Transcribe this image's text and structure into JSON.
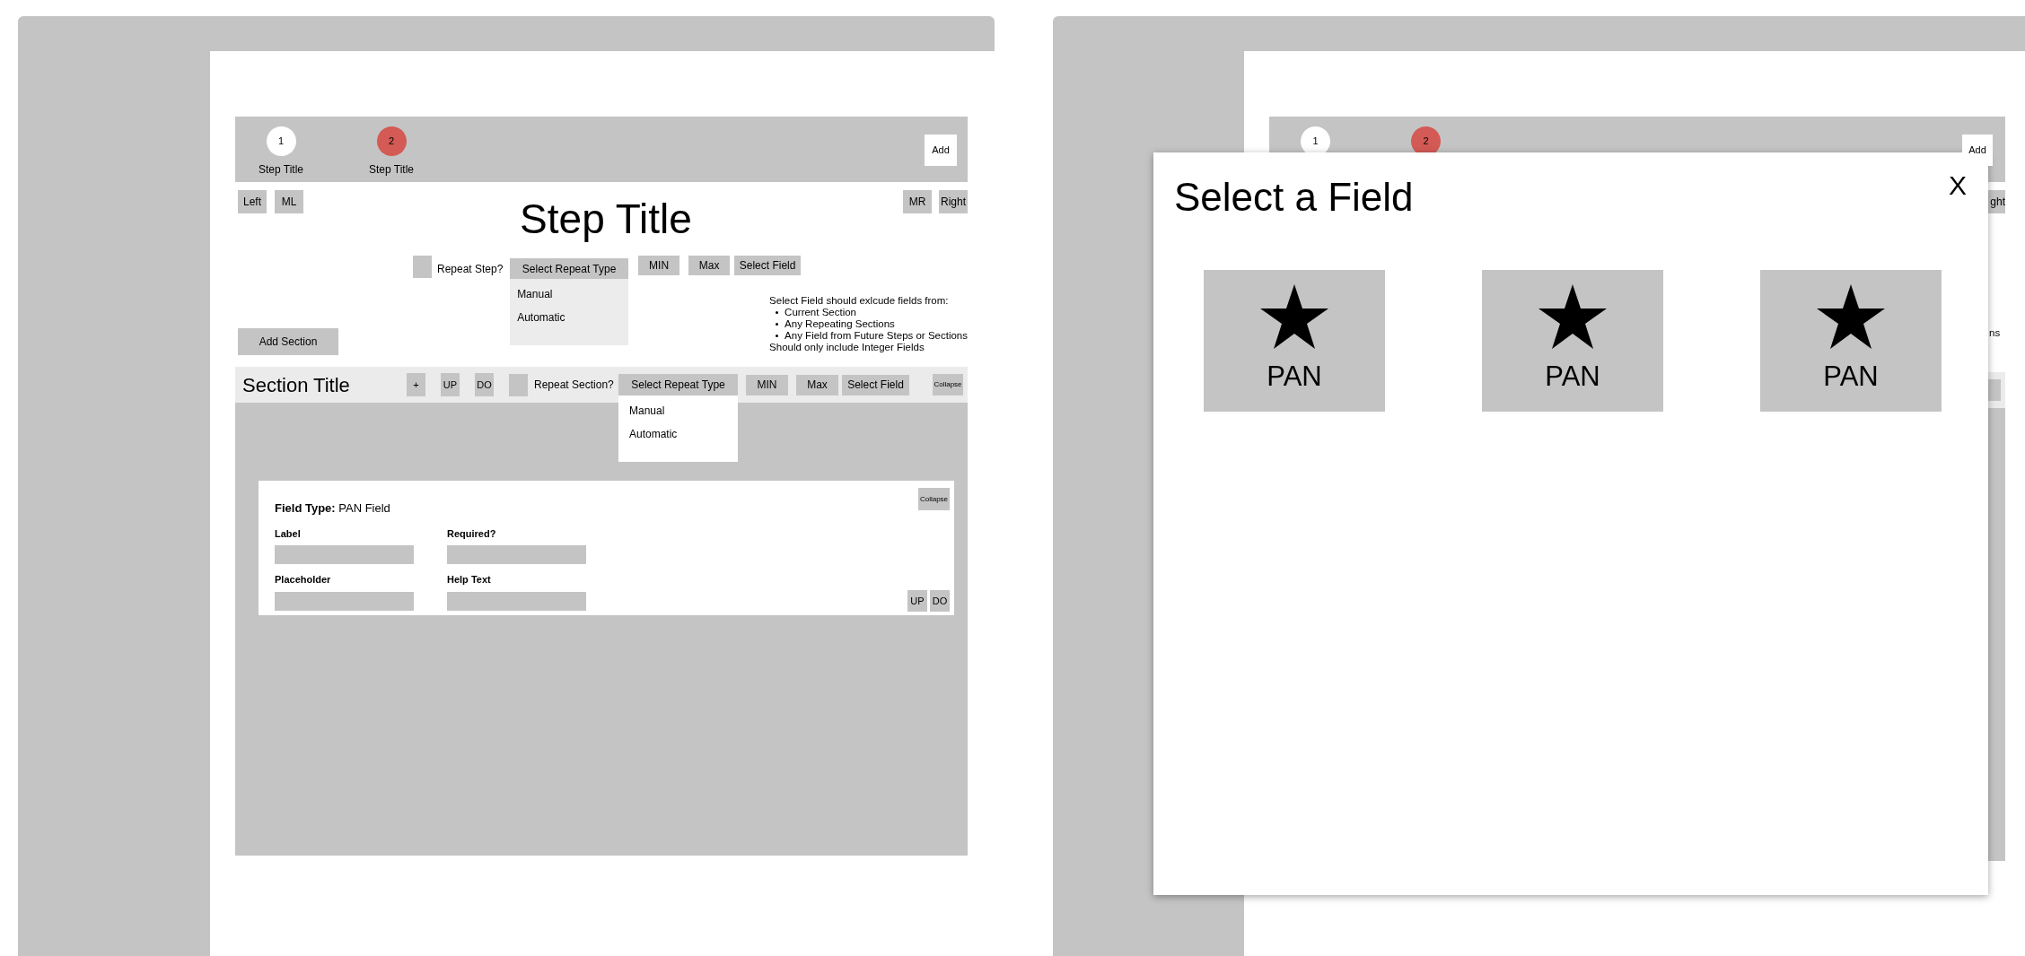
{
  "editor": {
    "steps": [
      {
        "number": "1",
        "label": "Step Title",
        "selected": false
      },
      {
        "number": "2",
        "label": "Step Title",
        "selected": true
      }
    ],
    "add_button": "Add",
    "nav_left": [
      "Left",
      "ML"
    ],
    "nav_right": [
      "MR",
      "Right"
    ],
    "step_title": "Step Title",
    "repeat_step": {
      "label": "Repeat Step?",
      "checked": false,
      "select": "Select Repeat Type",
      "options": [
        "Manual",
        "Automatic"
      ],
      "buttons": [
        "MIN",
        "Max",
        "Select Field"
      ]
    },
    "note": {
      "intro": "Select Field should exlcude fields from:",
      "items": [
        "Current Section",
        "Any Repeating Sections",
        "Any Field from Future Steps or Sections"
      ],
      "footer": "Should only include Integer Fields"
    },
    "add_section": "Add Section",
    "section": {
      "title": "Section Title",
      "tools": [
        "+",
        "UP",
        "DO"
      ],
      "repeat_label": "Repeat Section?",
      "checked": false,
      "select": "Select Repeat Type",
      "options": [
        "Manual",
        "Automatic"
      ],
      "buttons": [
        "MIN",
        "Max",
        "Select Field"
      ],
      "collapse": "Collapse",
      "field": {
        "type": "**Field Type:** PAN Field",
        "collapse": "Collapse",
        "inputs": [
          {
            "label": "Label"
          },
          {
            "label": "Required?"
          },
          {
            "label": "Placeholder"
          },
          {
            "label": "Help Text"
          }
        ],
        "move_buttons": [
          "UP",
          "DO"
        ]
      }
    }
  },
  "background_page": {
    "steps": [
      {
        "number": "1",
        "selected": false
      },
      {
        "number": "2",
        "selected": true
      }
    ],
    "add_button": "Add",
    "right_button": "ght",
    "note_fragment": "ns"
  },
  "modal": {
    "title": "Select a Field",
    "close": "X",
    "fields": [
      {
        "label": "PAN"
      },
      {
        "label": "PAN"
      },
      {
        "label": "PAN"
      }
    ]
  }
}
